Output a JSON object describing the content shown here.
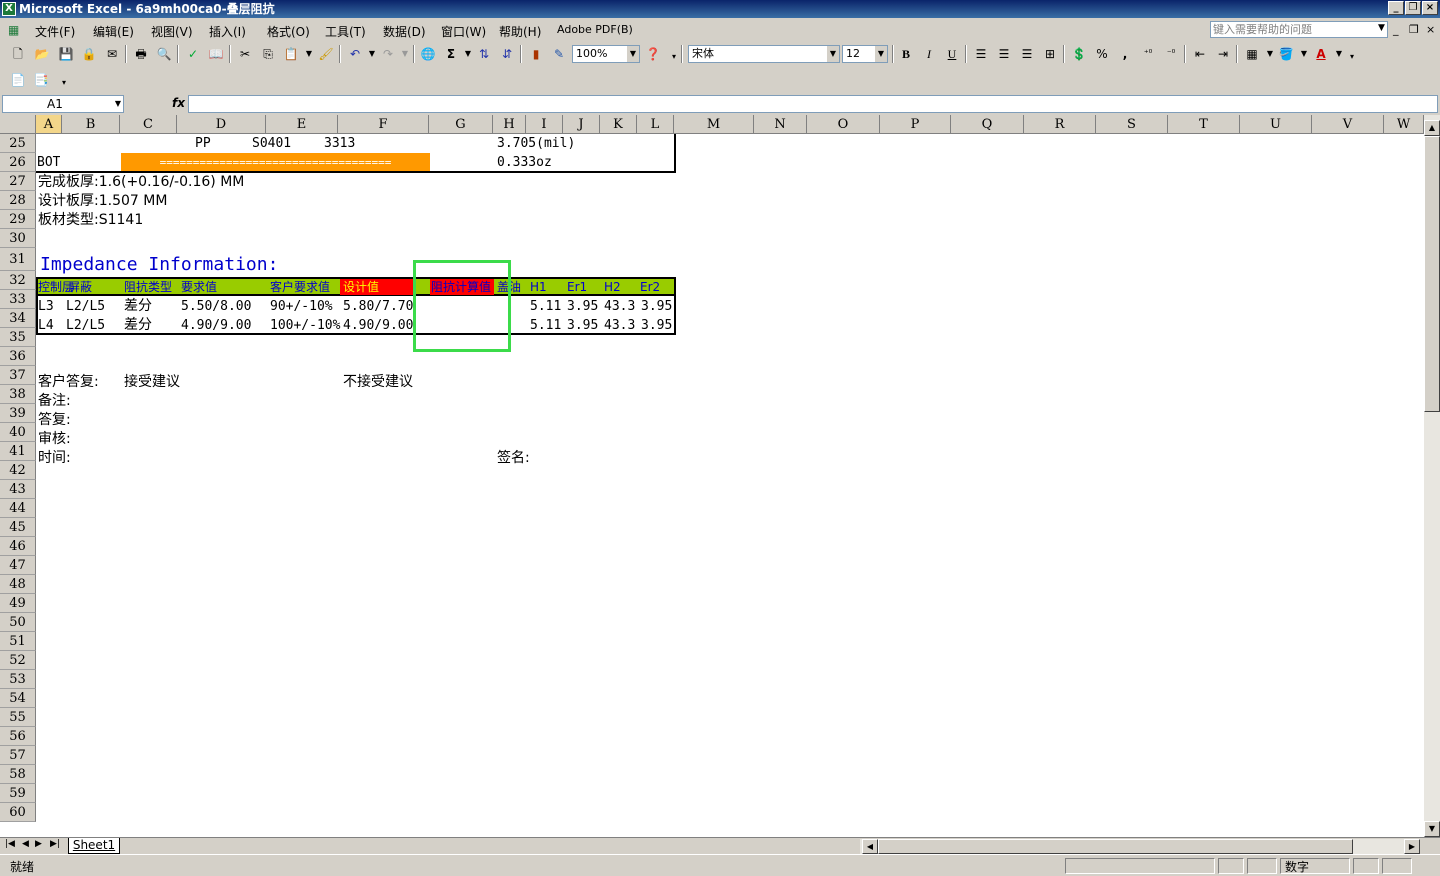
{
  "window": {
    "title": "Microsoft Excel - 6a9mh00ca0-叠层阻抗",
    "app_icon": "X"
  },
  "menu": {
    "items": [
      "文件(F)",
      "编辑(E)",
      "视图(V)",
      "插入(I)",
      "格式(O)",
      "工具(T)",
      "数据(D)",
      "窗口(W)",
      "帮助(H)",
      "Adobe PDF(B)"
    ],
    "help_placeholder": "键入需要帮助的问题"
  },
  "toolbar": {
    "zoom": "100%",
    "font_name": "宋体",
    "font_size": "12",
    "bold": "B",
    "italic": "I",
    "underline": "U",
    "percent": "%",
    "comma": ",",
    "sum": "Σ"
  },
  "formula_bar": {
    "name_box": "A1",
    "fx": "fx",
    "content": ""
  },
  "columns": [
    "A",
    "B",
    "C",
    "D",
    "E",
    "F",
    "G",
    "H",
    "I",
    "J",
    "K",
    "L",
    "M",
    "N",
    "O",
    "P",
    "Q",
    "R",
    "S",
    "T",
    "U",
    "V",
    "W"
  ],
  "rows": [
    "25",
    "26",
    "27",
    "28",
    "29",
    "30",
    "31",
    "32",
    "33",
    "34",
    "35",
    "36",
    "37",
    "38",
    "39",
    "40",
    "41",
    "42",
    "43",
    "44",
    "45",
    "46",
    "47",
    "48",
    "49",
    "50",
    "51",
    "52",
    "53",
    "54",
    "55",
    "56",
    "57",
    "58",
    "59",
    "60"
  ],
  "sheet": {
    "r25": {
      "d": "PP",
      "e1": "S0401",
      "e2": "3313",
      "h": "3.705(mil)"
    },
    "r26": {
      "a": "BOT",
      "bar": "===================================",
      "h": "0.333oz"
    },
    "r27": "完成板厚:1.6(+0.16/-0.16) MM",
    "r28": "设计板厚:1.507 MM",
    "r29": "板材类型:S1141",
    "r31": "Impedance Information:",
    "r32": {
      "a": "控制层",
      "b": "屏蔽",
      "c": "阻抗类型",
      "d": "要求值",
      "e": "客户要求值",
      "f": "设计值",
      "g": "阻抗计算值",
      "h": "盖油",
      "i": "H1",
      "j": "Er1",
      "k": "H2",
      "l": "Er2"
    },
    "r33": {
      "a": "L3",
      "b": "L2/L5",
      "c": "差分",
      "d": "5.50/8.00",
      "e": "90+/-10%",
      "f": "5.80/7.70",
      "i": "5.11",
      "j": "3.95",
      "k": "43.3",
      "l": "3.95"
    },
    "r34": {
      "a": "L4",
      "b": "L2/L5",
      "c": "差分",
      "d": "4.90/9.00",
      "e": "100+/-10%",
      "f": "4.90/9.00",
      "i": "5.11",
      "j": "3.95",
      "k": "43.3",
      "l": "3.95"
    },
    "r37": {
      "a": "客户答复:",
      "c": "接受建议",
      "f": "不接受建议"
    },
    "r38": "备注:",
    "r39": "答复:",
    "r40": "审核:",
    "r41": {
      "a": "时间:",
      "h": "签名:"
    }
  },
  "tabs": {
    "active": "Sheet1"
  },
  "status": {
    "left": "就绪",
    "mode": "数字"
  },
  "colors": {
    "header_green": "#99cc00",
    "design_red": "#ff0000",
    "bar_orange": "#ff9900",
    "impedance_blue": "#0000cc",
    "highlight_box": "#3bdb4a"
  }
}
